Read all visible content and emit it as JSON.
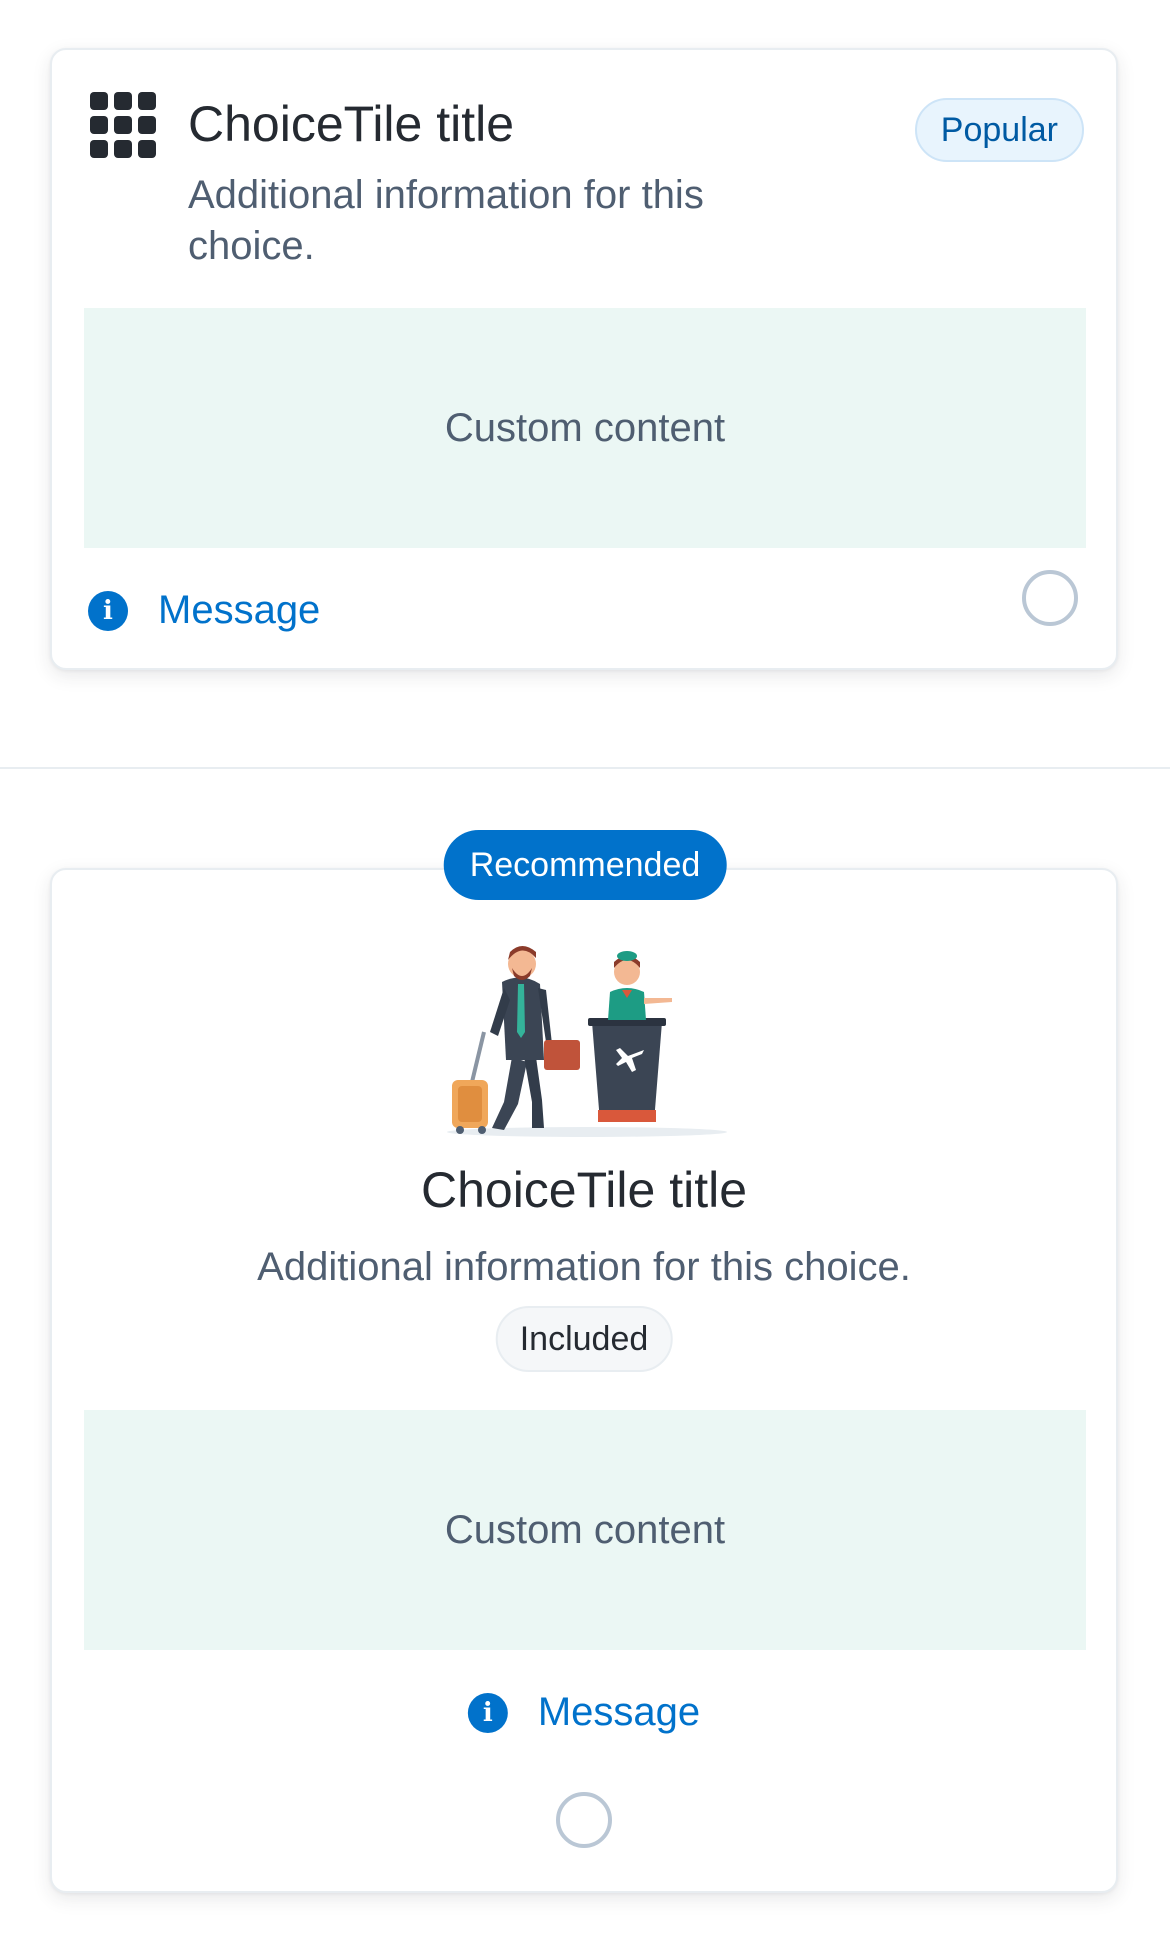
{
  "tile1": {
    "icon": "grid-icon",
    "title": "ChoiceTile title",
    "description": "Additional information for this choice.",
    "badge": "Popular",
    "custom_content": "Custom content",
    "message": "Message",
    "selected": false
  },
  "tile2": {
    "badge": "Recommended",
    "illustration": "traveler-check-in-illustration",
    "title": "ChoiceTile title",
    "description": "Additional information for this choice.",
    "badge_included": "Included",
    "custom_content": "Custom content",
    "message": "Message",
    "selected": false
  },
  "colors": {
    "primary": "#0172cb",
    "custom_bg": "#ebf7f4",
    "popular_bg": "#e8f4fd",
    "text": "#252a31",
    "secondary_text": "#4f5e71"
  }
}
